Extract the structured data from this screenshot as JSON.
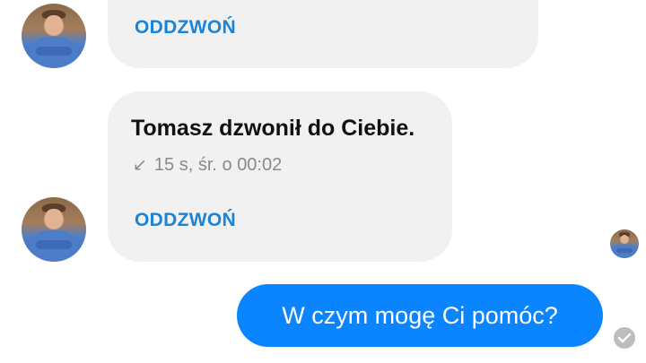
{
  "thread": {
    "messages": [
      {
        "callback_label": "ODDZWOŃ"
      },
      {
        "title": "Tomasz dzwonił do Ciebie.",
        "meta_icon": "↙",
        "meta": "15 s, śr. o 00:02",
        "callback_label": "ODDZWOŃ"
      }
    ],
    "sent": {
      "text": "W czym mogę Ci pomóc?"
    }
  },
  "colors": {
    "accent": "#1a84d8",
    "sent_bubble": "#0a84ff",
    "received_bubble": "#f1f1f1"
  },
  "icons": {
    "avatar": "avatar",
    "missed_call": "incoming-call-arrow-icon",
    "seen": "seen-check-icon"
  }
}
